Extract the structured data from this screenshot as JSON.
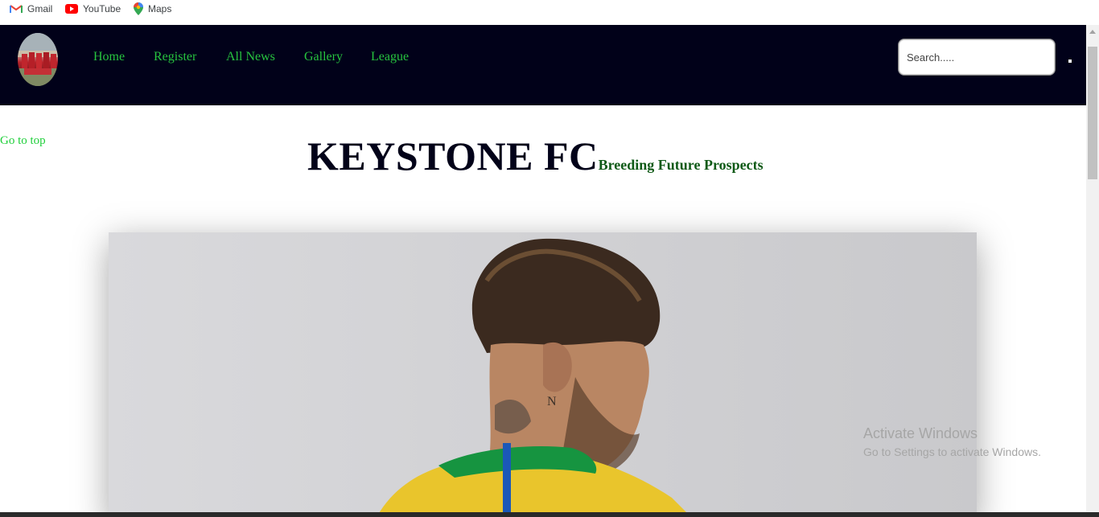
{
  "bookmarks": [
    {
      "label": "Gmail",
      "icon": "gmail-icon"
    },
    {
      "label": "YouTube",
      "icon": "youtube-icon"
    },
    {
      "label": "Maps",
      "icon": "maps-icon"
    }
  ],
  "nav": {
    "links": [
      "Home",
      "Register",
      "All News",
      "Gallery",
      "League"
    ],
    "search_placeholder": "Search....."
  },
  "page": {
    "goto_top": "Go to top",
    "title": "KEYSTONE FC",
    "tagline": "Breeding Future Prospects"
  },
  "watermark": {
    "line1": "Activate Windows",
    "line2": "Go to Settings to activate Windows."
  },
  "colors": {
    "navbar_bg": "#010119",
    "nav_link": "#27c43f",
    "title": "#020219",
    "tagline": "#0f5a17"
  }
}
